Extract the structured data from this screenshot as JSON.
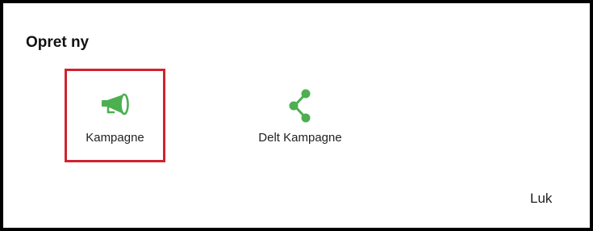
{
  "dialog": {
    "title": "Opret ny",
    "close_label": "Luk"
  },
  "options": [
    {
      "label": "Kampagne",
      "icon": "megaphone-icon",
      "selected": true
    },
    {
      "label": "Delt Kampagne",
      "icon": "share-icon",
      "selected": false
    }
  ],
  "colors": {
    "icon_green": "#4caf50",
    "selection_red": "#d0232f",
    "border": "#000000"
  }
}
